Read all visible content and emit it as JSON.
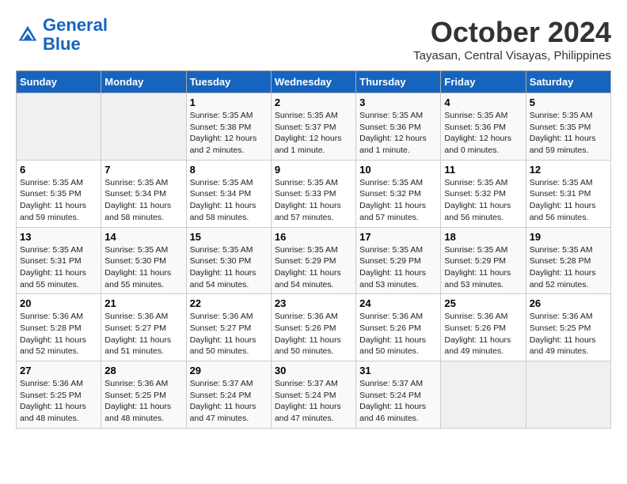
{
  "header": {
    "logo_line1": "General",
    "logo_line2": "Blue",
    "month": "October 2024",
    "location": "Tayasan, Central Visayas, Philippines"
  },
  "weekdays": [
    "Sunday",
    "Monday",
    "Tuesday",
    "Wednesday",
    "Thursday",
    "Friday",
    "Saturday"
  ],
  "weeks": [
    [
      {
        "day": "",
        "empty": true
      },
      {
        "day": "",
        "empty": true
      },
      {
        "day": "1",
        "sunrise": "5:35 AM",
        "sunset": "5:38 PM",
        "daylight": "12 hours and 2 minutes."
      },
      {
        "day": "2",
        "sunrise": "5:35 AM",
        "sunset": "5:37 PM",
        "daylight": "12 hours and 1 minute."
      },
      {
        "day": "3",
        "sunrise": "5:35 AM",
        "sunset": "5:36 PM",
        "daylight": "12 hours and 1 minute."
      },
      {
        "day": "4",
        "sunrise": "5:35 AM",
        "sunset": "5:36 PM",
        "daylight": "12 hours and 0 minutes."
      },
      {
        "day": "5",
        "sunrise": "5:35 AM",
        "sunset": "5:35 PM",
        "daylight": "11 hours and 59 minutes."
      }
    ],
    [
      {
        "day": "6",
        "sunrise": "5:35 AM",
        "sunset": "5:35 PM",
        "daylight": "11 hours and 59 minutes."
      },
      {
        "day": "7",
        "sunrise": "5:35 AM",
        "sunset": "5:34 PM",
        "daylight": "11 hours and 58 minutes."
      },
      {
        "day": "8",
        "sunrise": "5:35 AM",
        "sunset": "5:34 PM",
        "daylight": "11 hours and 58 minutes."
      },
      {
        "day": "9",
        "sunrise": "5:35 AM",
        "sunset": "5:33 PM",
        "daylight": "11 hours and 57 minutes."
      },
      {
        "day": "10",
        "sunrise": "5:35 AM",
        "sunset": "5:32 PM",
        "daylight": "11 hours and 57 minutes."
      },
      {
        "day": "11",
        "sunrise": "5:35 AM",
        "sunset": "5:32 PM",
        "daylight": "11 hours and 56 minutes."
      },
      {
        "day": "12",
        "sunrise": "5:35 AM",
        "sunset": "5:31 PM",
        "daylight": "11 hours and 56 minutes."
      }
    ],
    [
      {
        "day": "13",
        "sunrise": "5:35 AM",
        "sunset": "5:31 PM",
        "daylight": "11 hours and 55 minutes."
      },
      {
        "day": "14",
        "sunrise": "5:35 AM",
        "sunset": "5:30 PM",
        "daylight": "11 hours and 55 minutes."
      },
      {
        "day": "15",
        "sunrise": "5:35 AM",
        "sunset": "5:30 PM",
        "daylight": "11 hours and 54 minutes."
      },
      {
        "day": "16",
        "sunrise": "5:35 AM",
        "sunset": "5:29 PM",
        "daylight": "11 hours and 54 minutes."
      },
      {
        "day": "17",
        "sunrise": "5:35 AM",
        "sunset": "5:29 PM",
        "daylight": "11 hours and 53 minutes."
      },
      {
        "day": "18",
        "sunrise": "5:35 AM",
        "sunset": "5:29 PM",
        "daylight": "11 hours and 53 minutes."
      },
      {
        "day": "19",
        "sunrise": "5:35 AM",
        "sunset": "5:28 PM",
        "daylight": "11 hours and 52 minutes."
      }
    ],
    [
      {
        "day": "20",
        "sunrise": "5:36 AM",
        "sunset": "5:28 PM",
        "daylight": "11 hours and 52 minutes."
      },
      {
        "day": "21",
        "sunrise": "5:36 AM",
        "sunset": "5:27 PM",
        "daylight": "11 hours and 51 minutes."
      },
      {
        "day": "22",
        "sunrise": "5:36 AM",
        "sunset": "5:27 PM",
        "daylight": "11 hours and 50 minutes."
      },
      {
        "day": "23",
        "sunrise": "5:36 AM",
        "sunset": "5:26 PM",
        "daylight": "11 hours and 50 minutes."
      },
      {
        "day": "24",
        "sunrise": "5:36 AM",
        "sunset": "5:26 PM",
        "daylight": "11 hours and 50 minutes."
      },
      {
        "day": "25",
        "sunrise": "5:36 AM",
        "sunset": "5:26 PM",
        "daylight": "11 hours and 49 minutes."
      },
      {
        "day": "26",
        "sunrise": "5:36 AM",
        "sunset": "5:25 PM",
        "daylight": "11 hours and 49 minutes."
      }
    ],
    [
      {
        "day": "27",
        "sunrise": "5:36 AM",
        "sunset": "5:25 PM",
        "daylight": "11 hours and 48 minutes."
      },
      {
        "day": "28",
        "sunrise": "5:36 AM",
        "sunset": "5:25 PM",
        "daylight": "11 hours and 48 minutes."
      },
      {
        "day": "29",
        "sunrise": "5:37 AM",
        "sunset": "5:24 PM",
        "daylight": "11 hours and 47 minutes."
      },
      {
        "day": "30",
        "sunrise": "5:37 AM",
        "sunset": "5:24 PM",
        "daylight": "11 hours and 47 minutes."
      },
      {
        "day": "31",
        "sunrise": "5:37 AM",
        "sunset": "5:24 PM",
        "daylight": "11 hours and 46 minutes."
      },
      {
        "day": "",
        "empty": true
      },
      {
        "day": "",
        "empty": true
      }
    ]
  ]
}
